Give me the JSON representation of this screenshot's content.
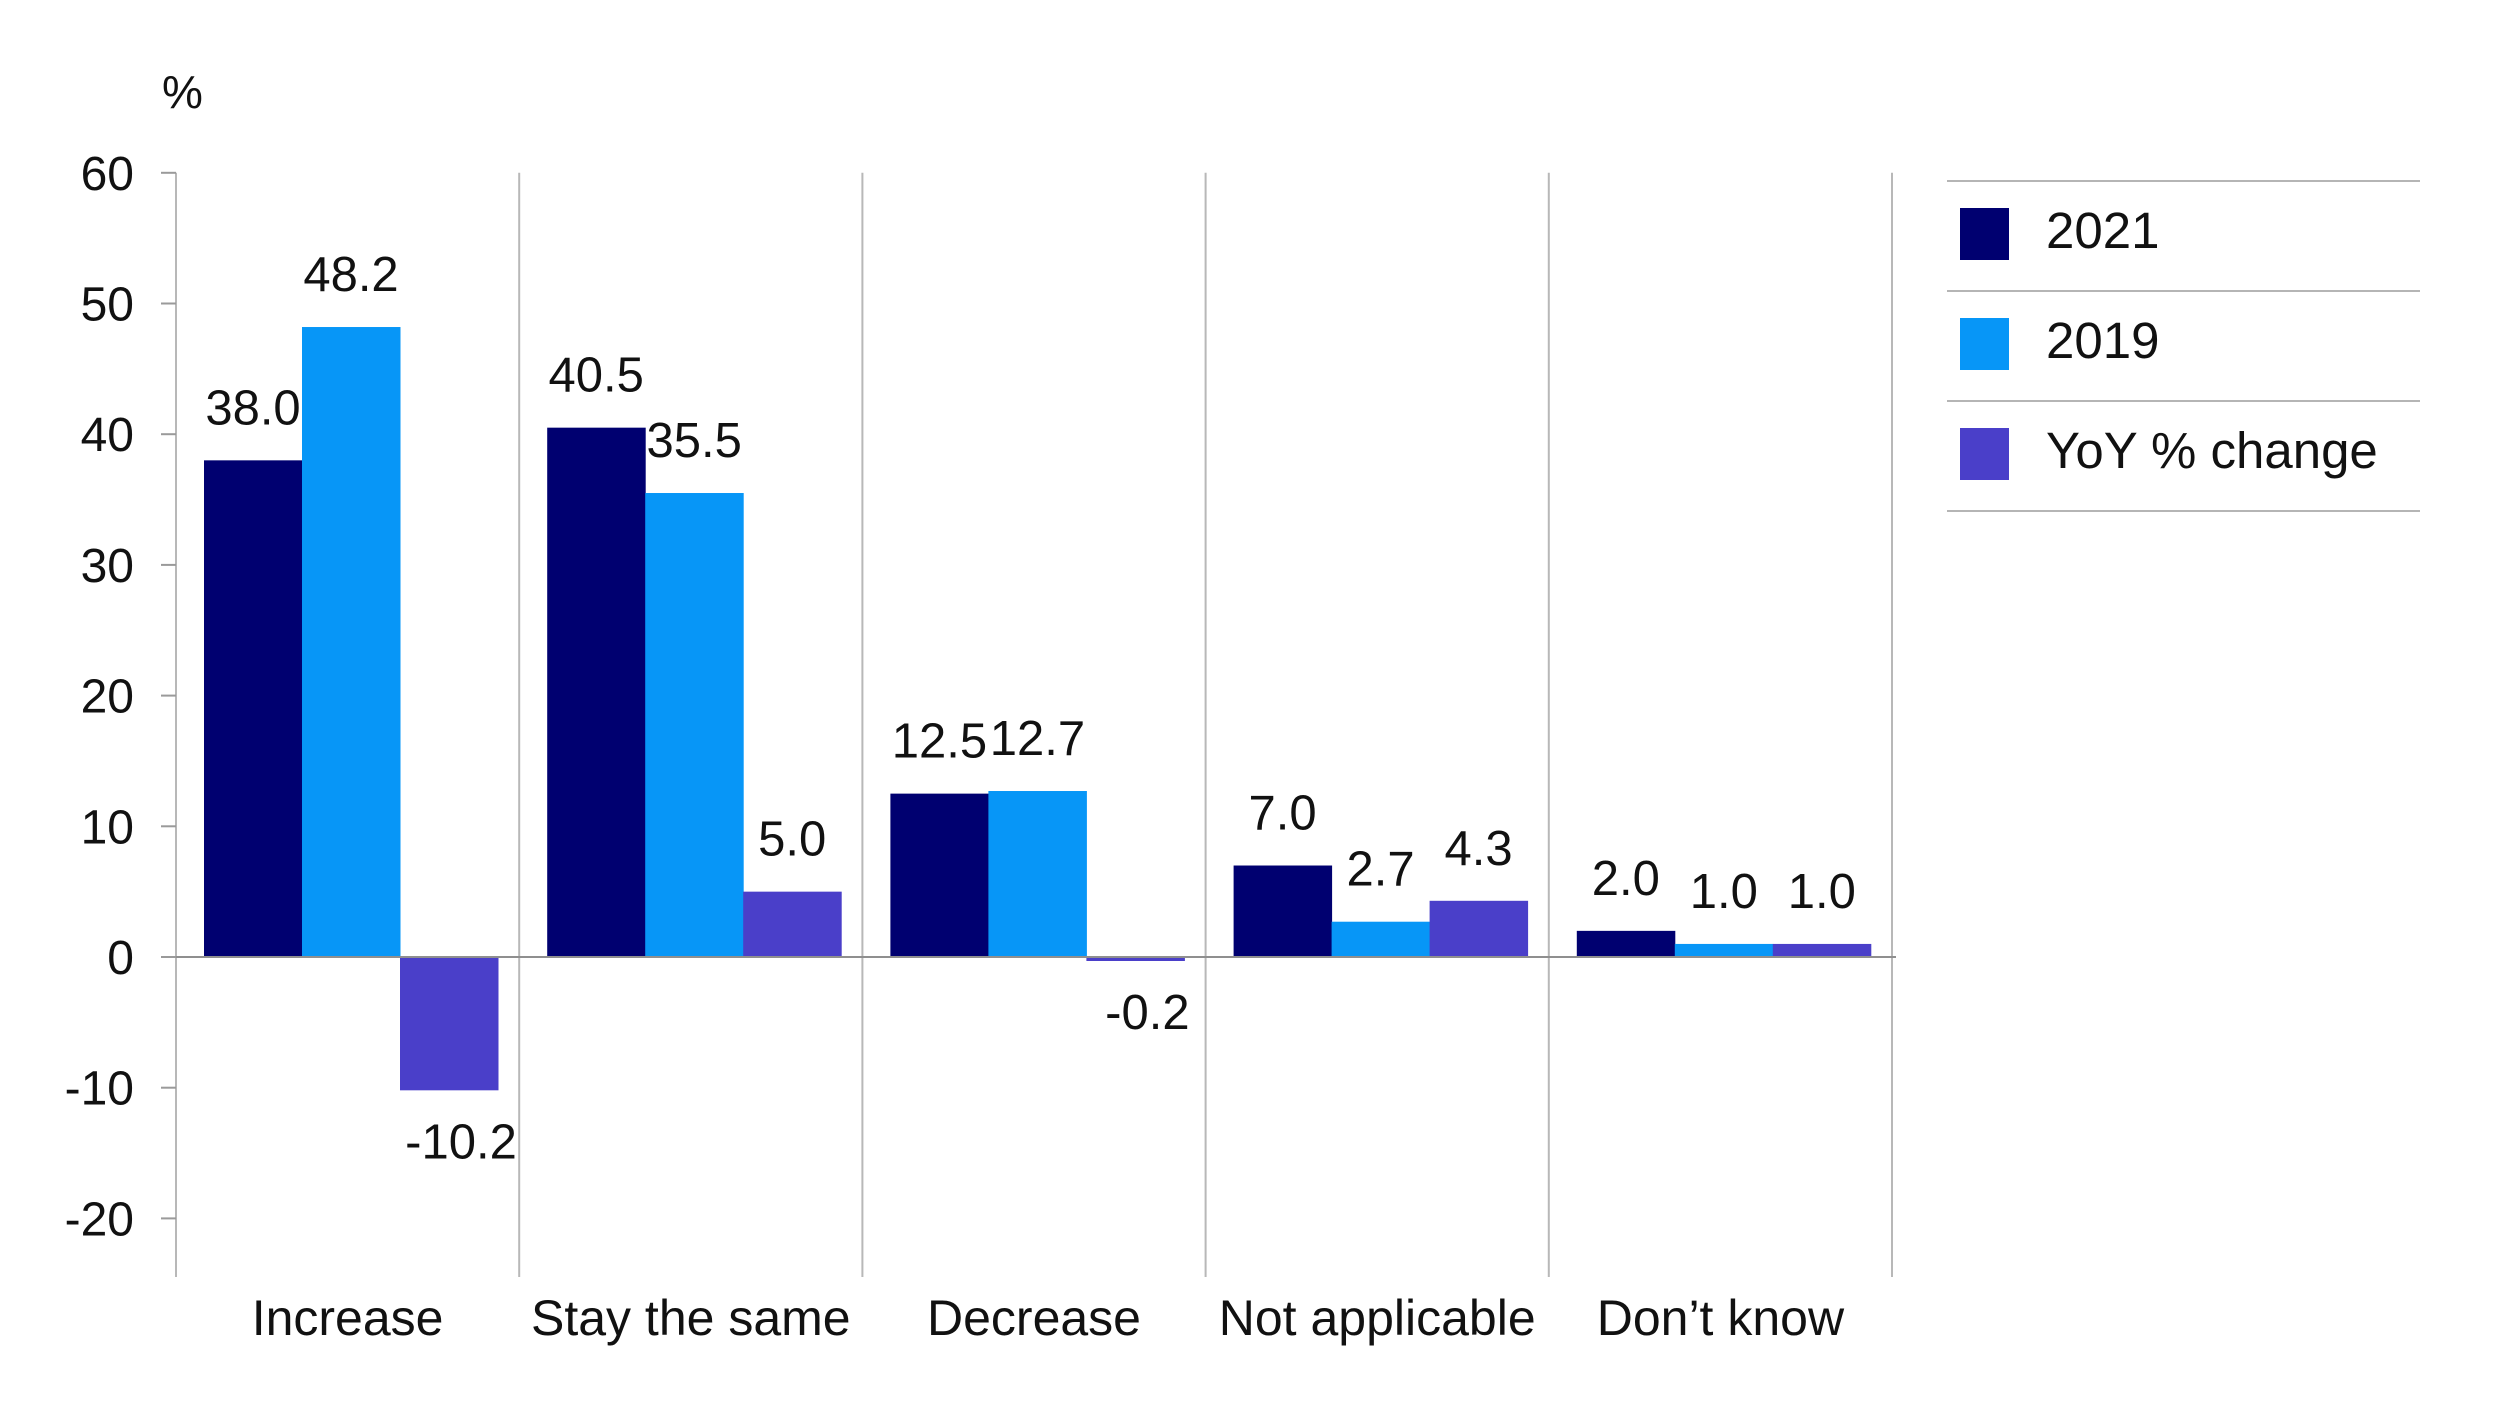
{
  "chart_data": {
    "type": "bar",
    "title": "",
    "xlabel": "",
    "ylabel": "%",
    "ylim": [
      -24,
      60
    ],
    "yticks": [
      60,
      50,
      40,
      30,
      20,
      10,
      0,
      -10,
      -20
    ],
    "grid": "vertical separators between categories",
    "legend_position": "right",
    "categories": [
      "Increase",
      "Stay the same",
      "Decrease",
      "Not applicable",
      "Don’t know"
    ],
    "series": [
      {
        "name": "2021",
        "color": "#000070",
        "values": [
          38.0,
          40.5,
          12.5,
          7.0,
          2.0
        ],
        "labels": [
          "38.0",
          "40.5",
          "12.5",
          "7.0",
          "2.0"
        ]
      },
      {
        "name": "2019",
        "color": "#0796F7",
        "values": [
          48.2,
          35.5,
          12.7,
          2.7,
          1.0
        ],
        "labels": [
          "48.2",
          "35.5",
          "12.7",
          "2.7",
          "1.0"
        ]
      },
      {
        "name": "YoY % change",
        "color": "#4A3FC9",
        "values": [
          -10.2,
          5.0,
          -0.2,
          4.3,
          1.0
        ],
        "labels": [
          "-10.2",
          "5.0",
          "-0.2",
          "4.3",
          "1.0"
        ]
      }
    ]
  }
}
